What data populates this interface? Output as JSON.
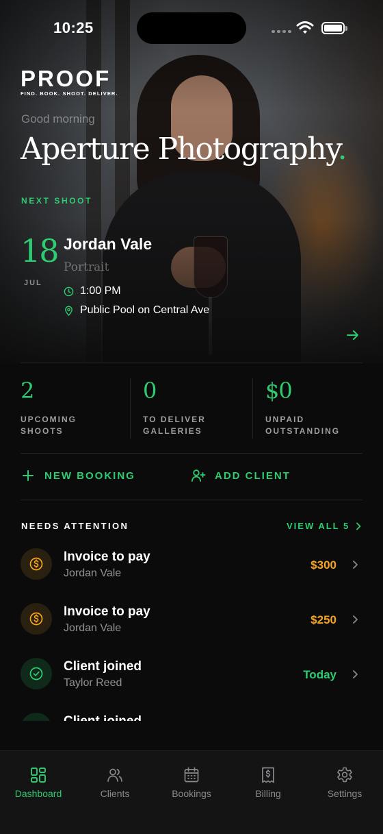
{
  "status_bar": {
    "time": "10:25"
  },
  "brand": {
    "wordmark": "PROOF",
    "tagline": "FIND. BOOK. SHOOT. DELIVER."
  },
  "header": {
    "greeting": "Good morning",
    "studio_name": "Aperture Photography",
    "studio_dot": "."
  },
  "next_shoot": {
    "label": "NEXT SHOOT",
    "day": "18",
    "month": "JUL",
    "client": "Jordan Vale",
    "type": "Portrait",
    "time": "1:00 PM",
    "location": "Public Pool on Central Ave"
  },
  "stats": [
    {
      "value": "2",
      "label_line1": "UPCOMING",
      "label_line2": "SHOOTS"
    },
    {
      "value": "0",
      "label_line1": "TO DELIVER",
      "label_line2": "GALLERIES"
    },
    {
      "value": "$0",
      "label_line1": "UNPAID",
      "label_line2": "OUTSTANDING"
    }
  ],
  "actions": {
    "new_booking": "NEW BOOKING",
    "add_client": "ADD CLIENT"
  },
  "attention": {
    "title": "NEEDS ATTENTION",
    "view_all": "VIEW ALL 5",
    "items": [
      {
        "icon": "dollar-icon",
        "title": "Invoice to pay",
        "subtitle": "Jordan Vale",
        "value": "$300"
      },
      {
        "icon": "dollar-icon",
        "title": "Invoice to pay",
        "subtitle": "Jordan Vale",
        "value": "$250"
      },
      {
        "icon": "check-circle-icon",
        "title": "Client joined",
        "subtitle": "Taylor Reed",
        "value": "Today"
      },
      {
        "icon": "check-circle-icon",
        "title": "Client joined",
        "subtitle": "",
        "value": ""
      }
    ]
  },
  "tabs": [
    {
      "label": "Dashboard",
      "icon": "grid-icon",
      "active": true
    },
    {
      "label": "Clients",
      "icon": "users-icon",
      "active": false
    },
    {
      "label": "Bookings",
      "icon": "calendar-icon",
      "active": false
    },
    {
      "label": "Billing",
      "icon": "receipt-icon",
      "active": false
    },
    {
      "label": "Settings",
      "icon": "gear-icon",
      "active": false
    }
  ],
  "colors": {
    "accent": "#2ecc71",
    "warning": "#f5a524",
    "background": "#0b0b0b"
  }
}
